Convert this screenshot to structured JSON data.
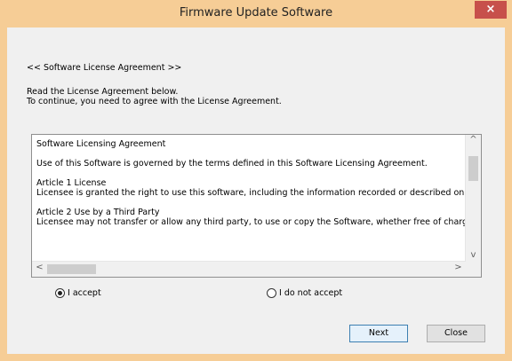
{
  "window": {
    "title": "Firmware Update Software",
    "close_glyph": "×"
  },
  "header": {
    "section": "<< Software License Agreement >>",
    "instruction_line1": "Read the License Agreement below.",
    "instruction_line2": "To continue, you need to agree with the License Agreement."
  },
  "license": {
    "lines": [
      "Software Licensing Agreement",
      "",
      "Use of this Software is governed by the terms defined in this Software Licensing Agreement.",
      "",
      "Article 1 License",
      "Licensee is granted the right to use this software, including the information recorded or described on the",
      "",
      "Article 2 Use by a Third Party",
      "Licensee may not transfer or allow any third party, to use or copy the Software, whether free of charge"
    ],
    "scroll_up": "^",
    "scroll_down": "v",
    "scroll_left": "<",
    "scroll_right": ">"
  },
  "options": {
    "accept_label": "I accept",
    "decline_label": "I do not accept",
    "selected": "accept"
  },
  "buttons": {
    "next_label": "Next",
    "close_label": "Close"
  },
  "colors": {
    "titlebar": "#f6cd96",
    "close_button": "#c7504b",
    "client": "#f0f0f0"
  }
}
